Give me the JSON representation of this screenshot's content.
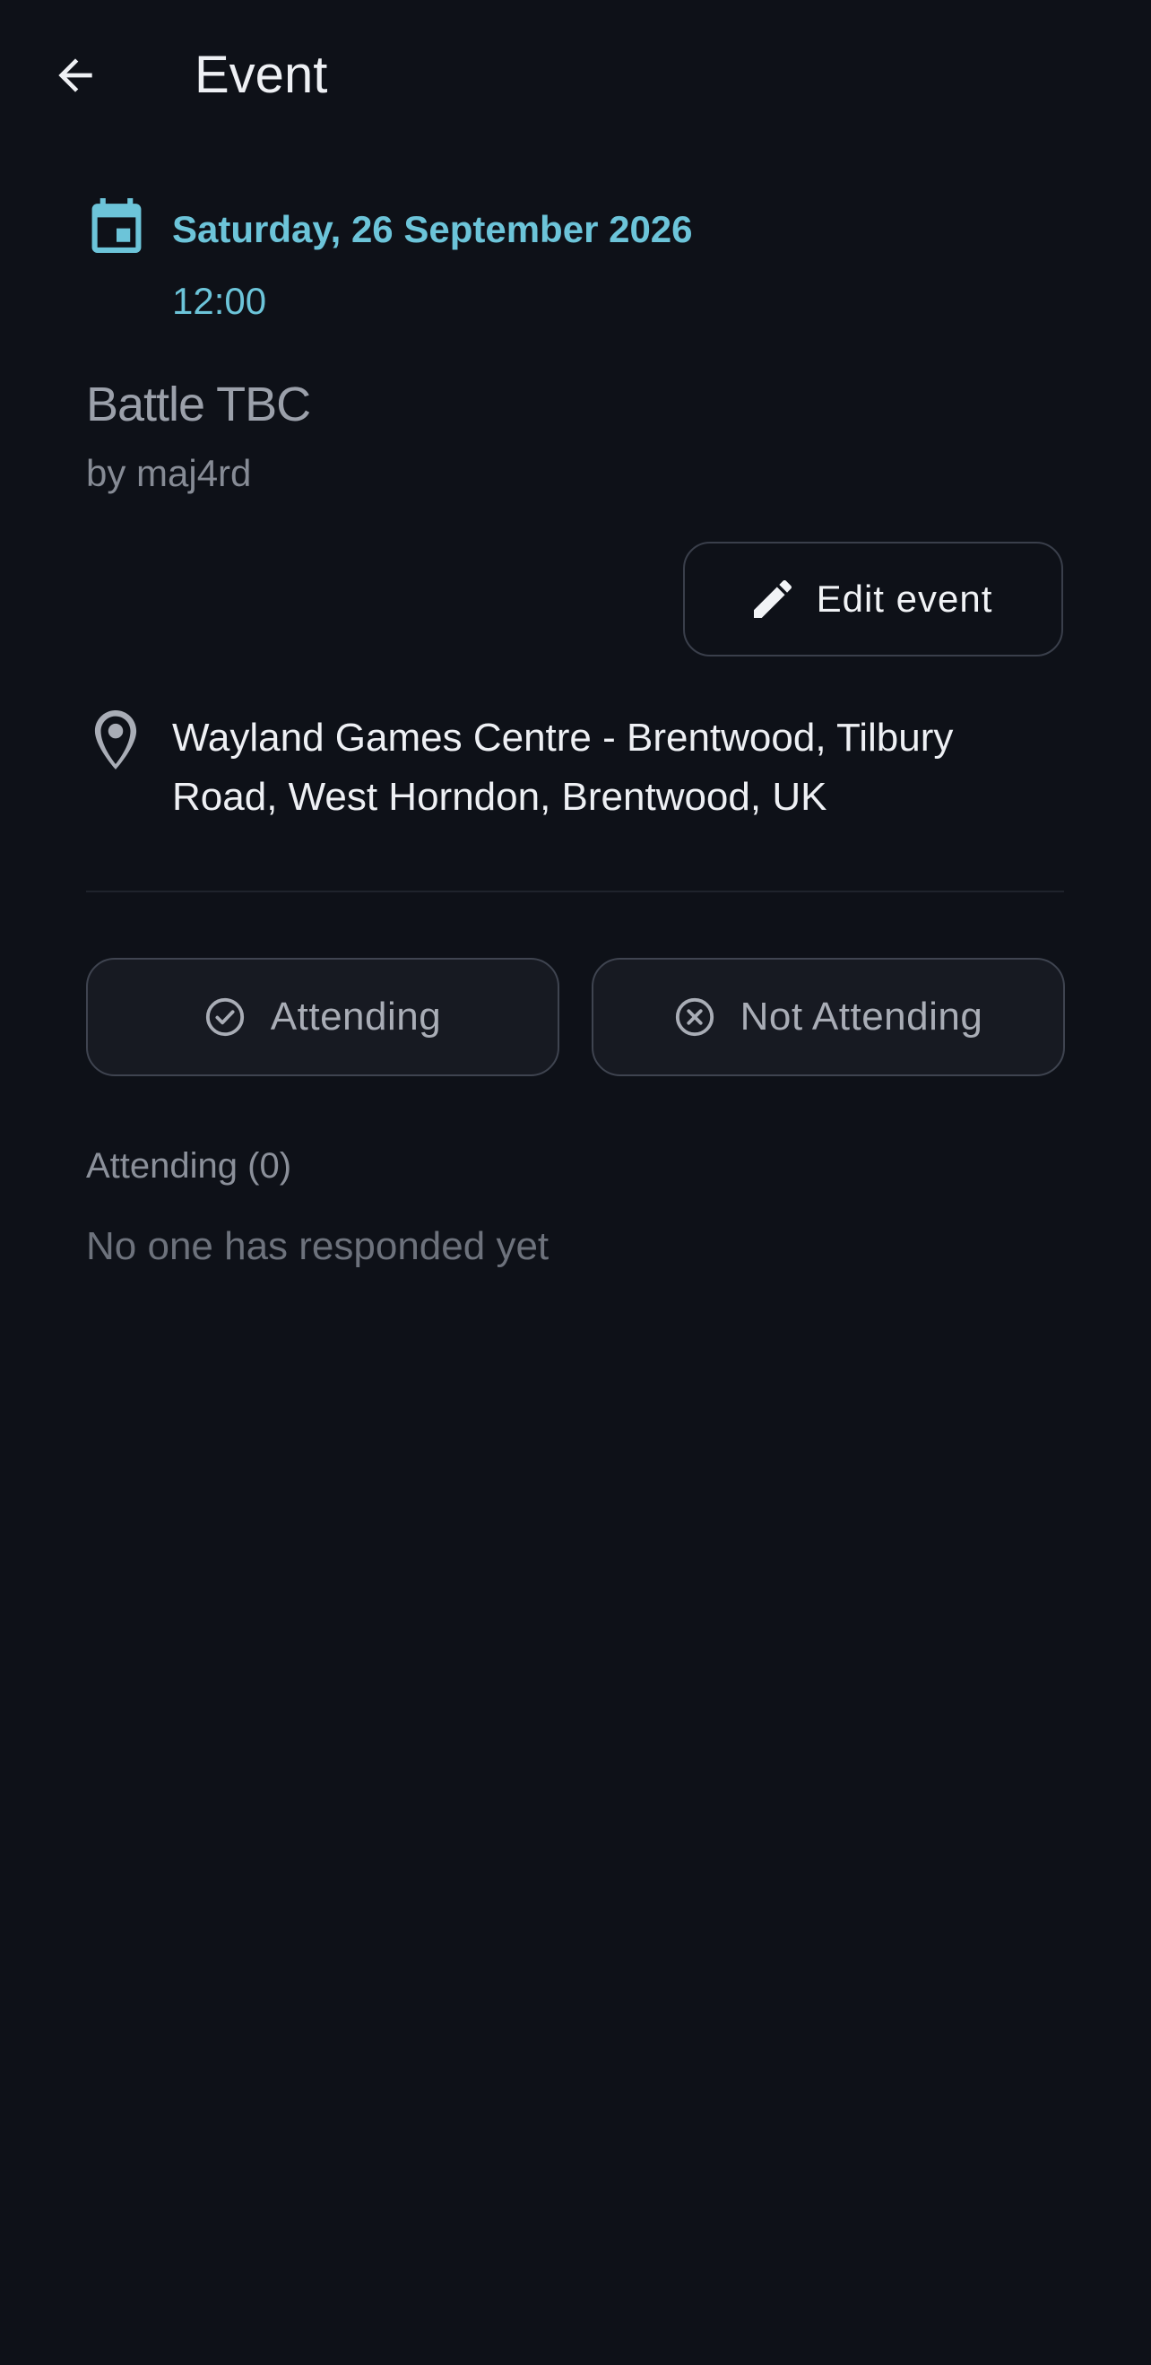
{
  "header": {
    "back_icon": "arrow-left-icon",
    "title": "Event"
  },
  "event": {
    "calendar_icon": "calendar-icon",
    "date": "Saturday, 26 September 2026",
    "time": "12:00",
    "name": "Battle TBC",
    "author": "by maj4rd",
    "accent_color": "#6cc4d9"
  },
  "actions": {
    "edit_icon": "pencil-icon",
    "edit_label": "Edit event"
  },
  "location": {
    "icon": "map-pin-icon",
    "address": "Wayland Games Centre - Brentwood, Tilbury Road, West Horndon, Brentwood, UK"
  },
  "rsvp": {
    "attending_icon": "check-circle-icon",
    "attending_label": "Attending",
    "not_attending_icon": "x-circle-icon",
    "not_attending_label": "Not Attending"
  },
  "attendees": {
    "heading": "Attending (0)",
    "empty_message": "No one has responded yet"
  }
}
